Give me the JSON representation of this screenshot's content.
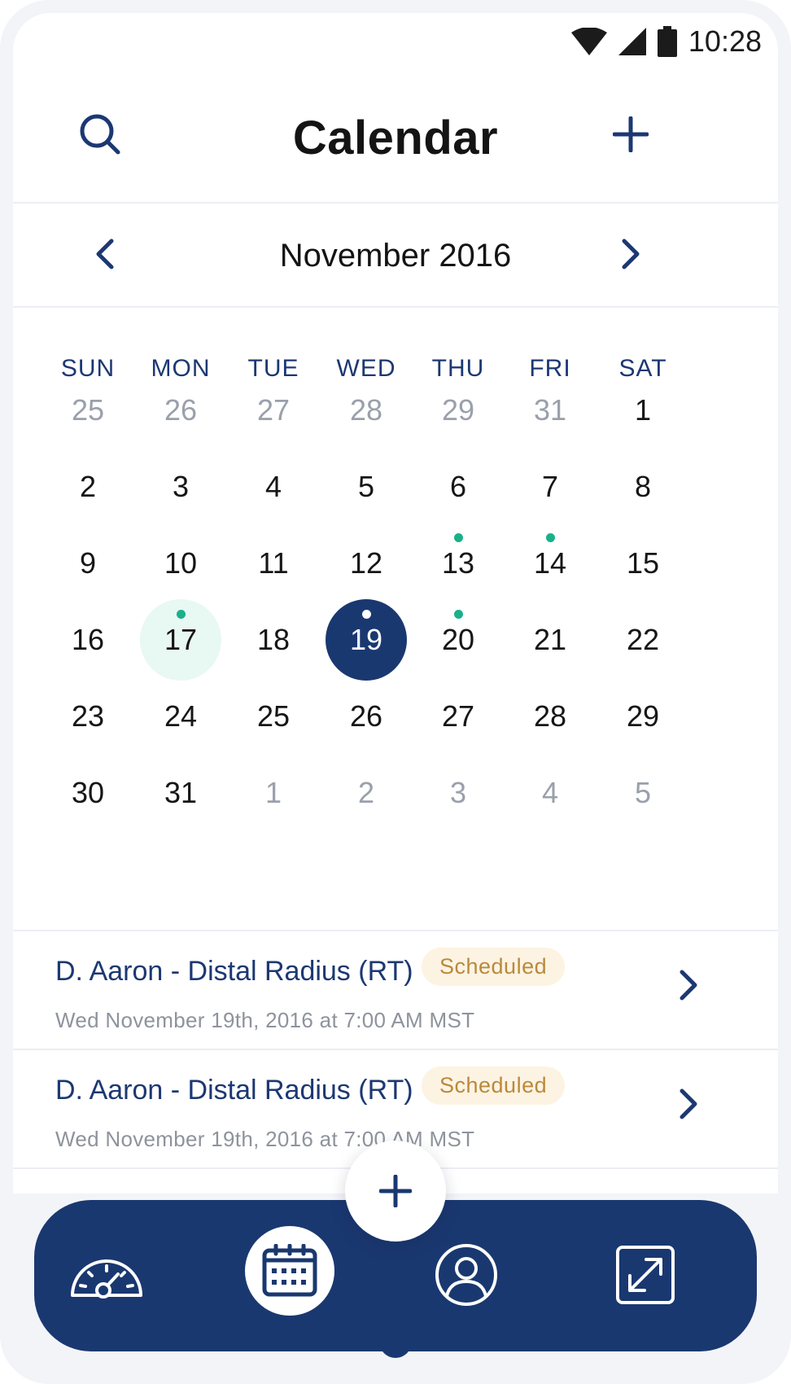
{
  "status_bar": {
    "time": "10:28"
  },
  "header": {
    "title": "Calendar",
    "search_icon": "search-icon",
    "add_icon": "plus-icon"
  },
  "month_nav": {
    "label": "November 2016",
    "prev_icon": "chevron-left-icon",
    "next_icon": "chevron-right-icon"
  },
  "weekdays": [
    "SUN",
    "MON",
    "TUE",
    "WED",
    "THU",
    "FRI",
    "SAT"
  ],
  "weeks": [
    [
      {
        "d": "25",
        "muted": true
      },
      {
        "d": "26",
        "muted": true
      },
      {
        "d": "27",
        "muted": true
      },
      {
        "d": "28",
        "muted": true
      },
      {
        "d": "29",
        "muted": true
      },
      {
        "d": "31",
        "muted": true
      },
      {
        "d": "1"
      }
    ],
    [
      {
        "d": "2"
      },
      {
        "d": "3"
      },
      {
        "d": "4"
      },
      {
        "d": "5"
      },
      {
        "d": "6"
      },
      {
        "d": "7"
      },
      {
        "d": "8"
      }
    ],
    [
      {
        "d": "9"
      },
      {
        "d": "10"
      },
      {
        "d": "11"
      },
      {
        "d": "12"
      },
      {
        "d": "13",
        "dot": true
      },
      {
        "d": "14",
        "dot": true
      },
      {
        "d": "15"
      }
    ],
    [
      {
        "d": "16"
      },
      {
        "d": "17",
        "dot": true,
        "today": true
      },
      {
        "d": "18"
      },
      {
        "d": "19",
        "dot": true,
        "selected": true
      },
      {
        "d": "20",
        "dot": true
      },
      {
        "d": "21"
      },
      {
        "d": "22"
      }
    ],
    [
      {
        "d": "23"
      },
      {
        "d": "24"
      },
      {
        "d": "25"
      },
      {
        "d": "26"
      },
      {
        "d": "27"
      },
      {
        "d": "28"
      },
      {
        "d": "29"
      }
    ],
    [
      {
        "d": "30"
      },
      {
        "d": "31"
      },
      {
        "d": "1",
        "muted": true
      },
      {
        "d": "2",
        "muted": true
      },
      {
        "d": "3",
        "muted": true
      },
      {
        "d": "4",
        "muted": true
      },
      {
        "d": "5",
        "muted": true
      }
    ]
  ],
  "appointments": [
    {
      "title": "D. Aaron - Distal Radius (RT)",
      "status": "Scheduled",
      "datetime": "Wed November 19th, 2016 at 7:00 AM MST"
    },
    {
      "title": "D. Aaron - Distal Radius (RT)",
      "status": "Scheduled",
      "datetime": "Wed November 19th, 2016 at 7:00 AM MST"
    }
  ],
  "bottom_nav": {
    "items": [
      {
        "name": "dashboard",
        "icon": "gauge-icon"
      },
      {
        "name": "calendar",
        "icon": "calendar-icon",
        "active": true
      },
      {
        "name": "profile",
        "icon": "user-icon"
      },
      {
        "name": "expand",
        "icon": "expand-icon"
      }
    ],
    "fab_icon": "plus-icon"
  },
  "colors": {
    "primary": "#1a3870",
    "event_dot": "#1ab08a",
    "today_bg": "#e8f8f3",
    "badge_bg": "#fdf3e3",
    "badge_text": "#b98a3b"
  }
}
